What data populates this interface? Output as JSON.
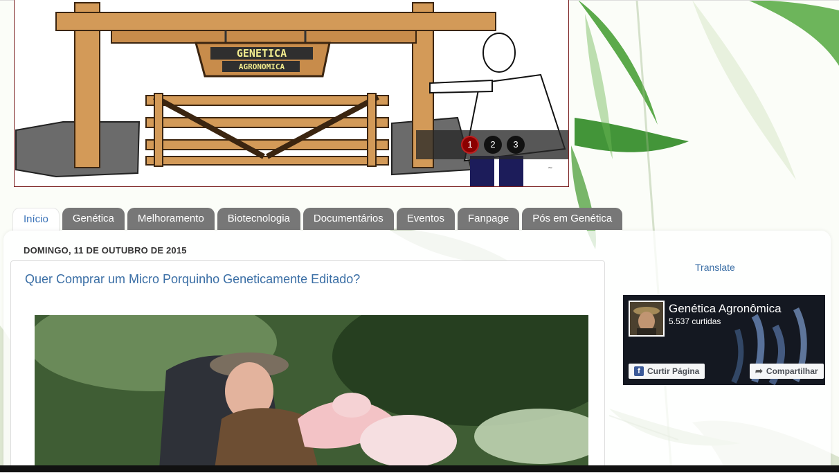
{
  "header": {
    "sign_line1": "GENETICA",
    "sign_line2": "AGRONOMICA",
    "slider": [
      {
        "label": "1",
        "active": true
      },
      {
        "label": "2",
        "active": false
      },
      {
        "label": "3",
        "active": false
      }
    ]
  },
  "nav": {
    "tabs": [
      {
        "label": "Início",
        "active": true
      },
      {
        "label": "Genética",
        "active": false
      },
      {
        "label": "Melhoramento",
        "active": false
      },
      {
        "label": "Biotecnologia",
        "active": false
      },
      {
        "label": "Documentários",
        "active": false
      },
      {
        "label": "Eventos",
        "active": false
      },
      {
        "label": "Fanpage",
        "active": false
      },
      {
        "label": "Pós em Genética",
        "active": false
      }
    ]
  },
  "post": {
    "date": "DOMINGO, 11 DE OUTUBRO DE 2015",
    "title": "Quer Comprar um Micro Porquinho Geneticamente Editado?"
  },
  "sidebar": {
    "translate_label": "Translate",
    "facebook": {
      "page_name": "Genética Agronômica",
      "likes": "5.537 curtidas",
      "like_button": "Curtir Página",
      "share_button": "Compartilhar"
    }
  },
  "colors": {
    "tab_bg": "#777777",
    "tab_active_text": "#3a72b8",
    "link": "#3a6ea5",
    "slider_active": "#8b0000",
    "facebook_blue": "#3b5998"
  },
  "icons": [
    "facebook-icon",
    "share-icon"
  ]
}
